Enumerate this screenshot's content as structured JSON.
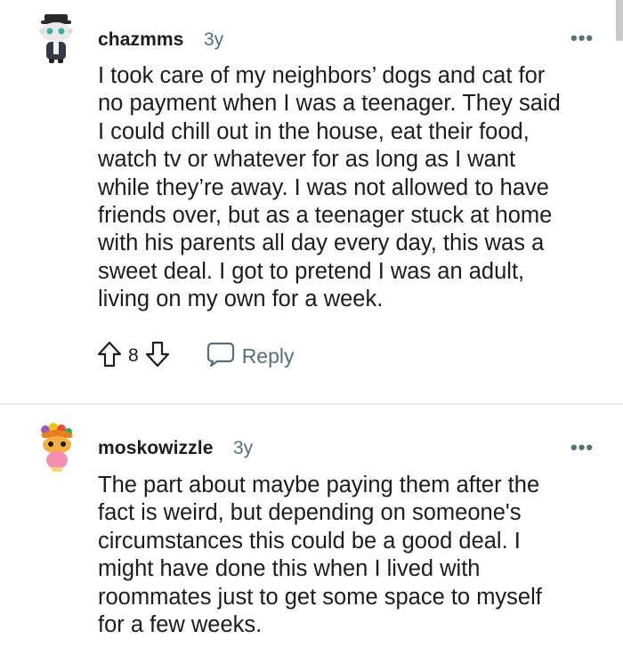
{
  "comments": [
    {
      "username": "chazmms",
      "timestamp": "3y",
      "more": "•••",
      "lines": [
        "I took care of my neighbors’ dogs and cat for",
        "no payment when I was a teenager. They said",
        "I could chill out in the house, eat their food,",
        "watch tv or whatever for as long as I want",
        "while they’re away. I was not allowed to have",
        "friends over, but as a teenager stuck at home",
        "with his parents all day every day, this was a",
        "sweet deal. I got to pretend I was an adult,",
        "living on my own for a week."
      ],
      "votes": "8",
      "reply_label": "Reply",
      "avatar_icon": "snoo-avatar-hat-icon"
    },
    {
      "username": "moskowizzle",
      "timestamp": "3y",
      "more": "•••",
      "lines": [
        "The part about maybe paying them after the",
        "fact is weird, but depending on someone's",
        "circumstances this could be a good deal. I",
        "might have done this when I lived with",
        "roommates just to get some space to myself",
        "for a few weeks."
      ],
      "avatar_icon": "snoo-avatar-fruit-hat-icon"
    }
  ],
  "colors": {
    "text": "#1c1c1c",
    "meta": "#576f76",
    "divider": "#e6e6e6"
  }
}
